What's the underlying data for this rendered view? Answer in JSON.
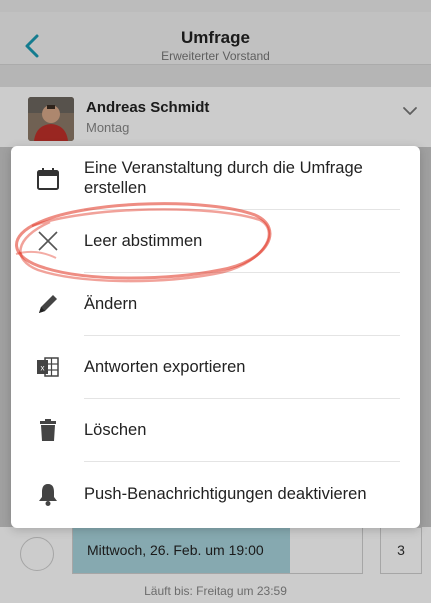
{
  "nav": {
    "title": "Umfrage",
    "subtitle": "Erweiterter Vorstand"
  },
  "post": {
    "author": "Andreas Schmidt",
    "day": "Montag"
  },
  "menu": {
    "items": [
      {
        "label": "Eine Veranstaltung durch die Umfrage erstellen",
        "icon": "calendar-icon"
      },
      {
        "label": "Leer abstimmen",
        "icon": "close-icon"
      },
      {
        "label": "Ändern",
        "icon": "pencil-icon"
      },
      {
        "label": "Antworten exportieren",
        "icon": "excel-icon"
      },
      {
        "label": "Löschen",
        "icon": "trash-icon"
      },
      {
        "label": "Push-Benachrichtigungen deaktivieren",
        "icon": "bell-icon"
      }
    ]
  },
  "option": {
    "label": "Mittwoch, 26. Feb. um 19:00",
    "count": "3",
    "fill_fraction": 0.75
  },
  "deadline": "Läuft bis: Freitag um 23:59",
  "colors": {
    "accent": "#1a9bb3",
    "option_fill": "#a8d4dc",
    "highlight_circle": "#e0301e"
  }
}
